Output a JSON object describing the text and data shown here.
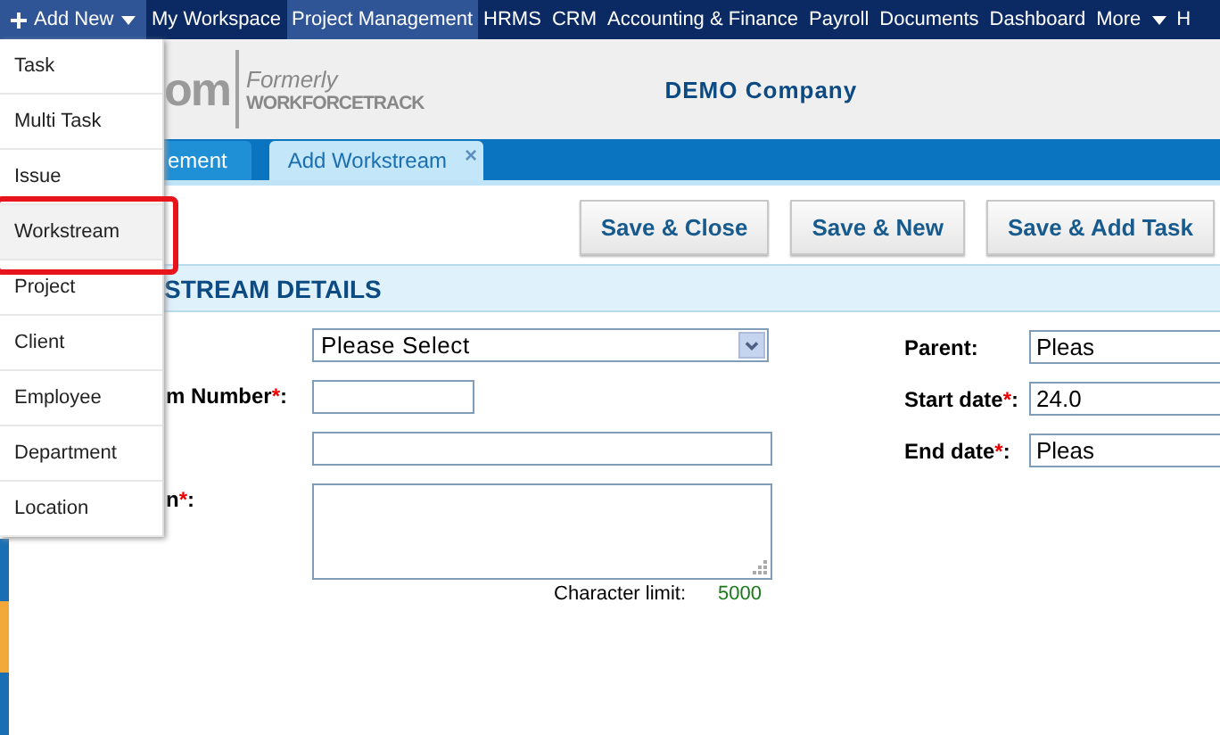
{
  "nav": {
    "add_new": "Add New",
    "items": [
      {
        "label": "My Workspace",
        "selected": false
      },
      {
        "label": "Project Management",
        "selected": true
      },
      {
        "label": "HRMS",
        "selected": false
      },
      {
        "label": "CRM",
        "selected": false
      },
      {
        "label": "Accounting & Finance",
        "selected": false
      },
      {
        "label": "Payroll",
        "selected": false
      },
      {
        "label": "Documents",
        "selected": false
      },
      {
        "label": "Dashboard",
        "selected": false
      },
      {
        "label": "More",
        "selected": false,
        "caret": true
      },
      {
        "label": "H",
        "selected": false
      }
    ]
  },
  "add_menu": {
    "items": [
      {
        "label": "Task",
        "selected": false
      },
      {
        "label": "Multi Task",
        "selected": false
      },
      {
        "label": "Issue",
        "selected": false
      },
      {
        "label": "Workstream",
        "selected": true
      },
      {
        "label": "Project",
        "selected": false
      },
      {
        "label": "Client",
        "selected": false
      },
      {
        "label": "Employee",
        "selected": false
      },
      {
        "label": "Department",
        "selected": false
      },
      {
        "label": "Location",
        "selected": false
      }
    ]
  },
  "header": {
    "logo": "om",
    "formerly": "Formerly",
    "former_name": "WORKFORCETRACK",
    "company": "DEMO Company"
  },
  "tabs": [
    {
      "label": "ement",
      "selected": false
    },
    {
      "label": "Add Workstream",
      "selected": true,
      "close": "×"
    }
  ],
  "buttons": [
    "Save & Close",
    "Save & New",
    "Save & Add Task"
  ],
  "section": {
    "title": "STREAM DETAILS"
  },
  "form_left": [
    {
      "kind": "select",
      "value": "Please Select"
    },
    {
      "kind": "input",
      "label": "m Number",
      "required_mark": "*",
      "suffix": ":"
    },
    {
      "kind": "input"
    },
    {
      "kind": "textarea",
      "label": "n",
      "required_mark": "*",
      "suffix": ":"
    }
  ],
  "char_limit": {
    "label": "Character limit:",
    "value": "5000"
  },
  "form_right": [
    {
      "label": "Parent",
      "suffix": ":",
      "value": "Pleas"
    },
    {
      "label": "Start date",
      "required_mark": "*",
      "suffix": ":",
      "value": "24.0"
    },
    {
      "label": "End date",
      "required_mark": "*",
      "suffix": ":",
      "value": "Pleas"
    }
  ]
}
